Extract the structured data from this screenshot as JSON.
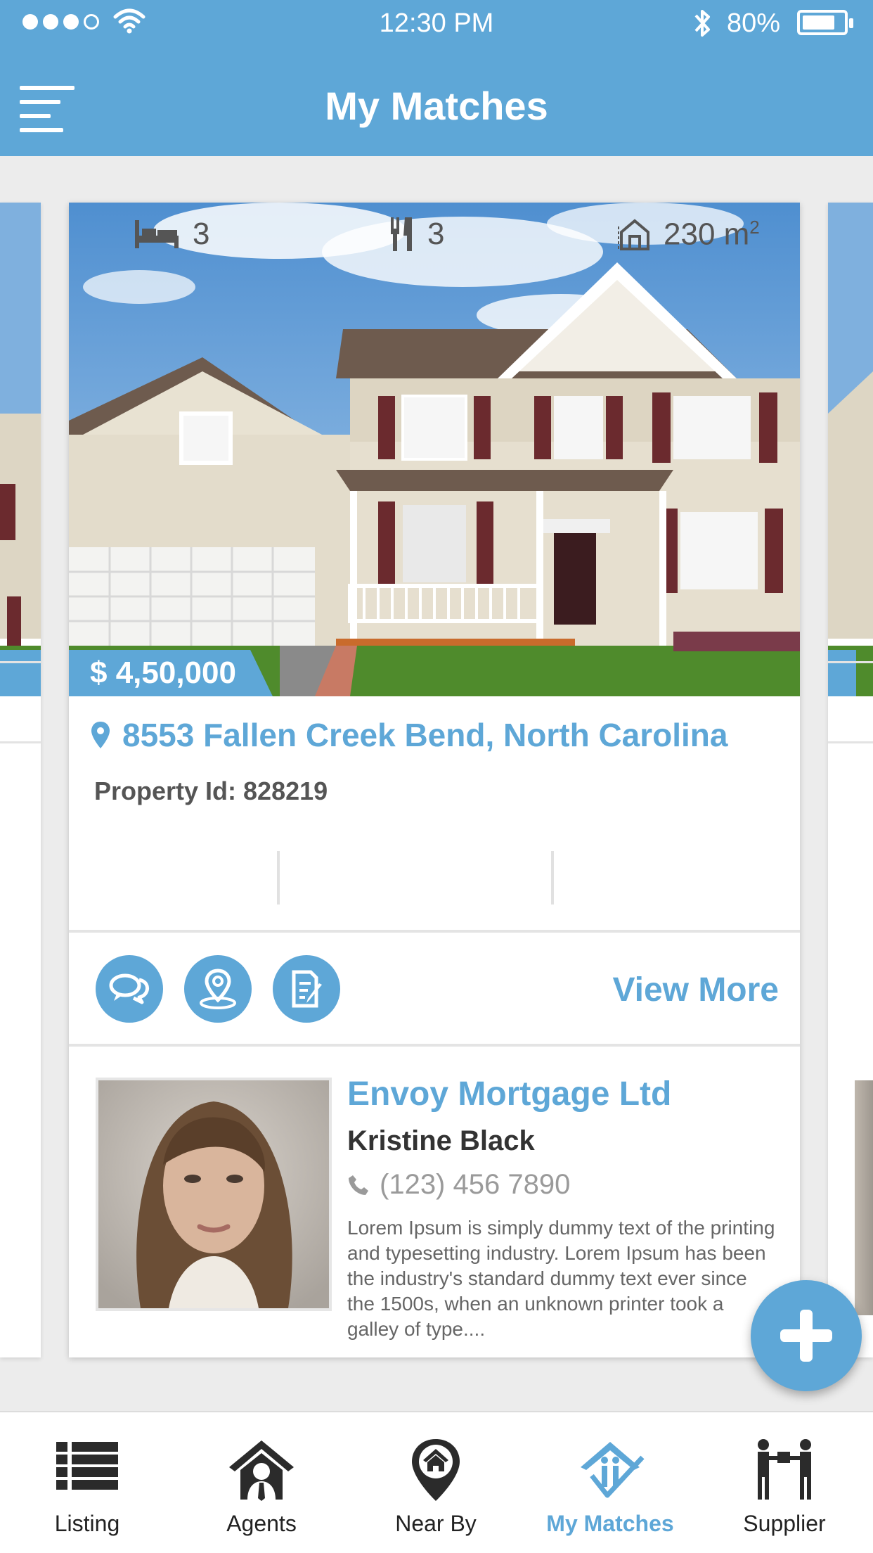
{
  "status_bar": {
    "time": "12:30 PM",
    "battery": "80%",
    "battery_level": 0.8
  },
  "header": {
    "title": "My Matches"
  },
  "card": {
    "price": "$ 4,50,000",
    "address": "8553 Fallen Creek Bend, North Carolina",
    "property_id": "Property Id: 828219",
    "bedrooms": "3",
    "dining": "3",
    "area": "230 m",
    "area_unit_sup": "2",
    "view_more": "View More",
    "agent": {
      "company": "Envoy Mortgage Ltd",
      "name": "Kristine Black",
      "phone": "(123) 456 7890",
      "bio": "Lorem Ipsum is simply dummy text of the printing and typesetting industry. Lorem Ipsum has been the industry's standard dummy text ever since the 1500s, when an unknown printer took a galley of type...."
    }
  },
  "tabs": [
    {
      "label": "Listing",
      "icon": "list-icon"
    },
    {
      "label": "Agents",
      "icon": "agent-house-icon"
    },
    {
      "label": "Near By",
      "icon": "location-house-icon"
    },
    {
      "label": "My Matches",
      "icon": "matches-icon",
      "active": true
    },
    {
      "label": "Supplier",
      "icon": "supplier-icon"
    }
  ],
  "colors": {
    "accent": "#5ea7d7",
    "background": "#ececec"
  }
}
